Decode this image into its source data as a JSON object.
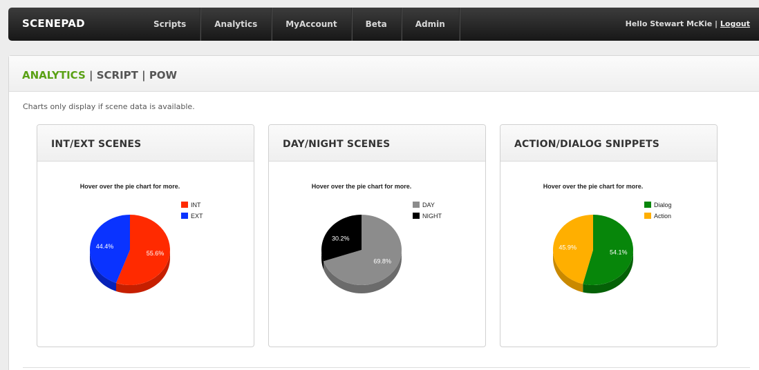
{
  "app": {
    "brand": "SCENEPAD",
    "nav": [
      "Scripts",
      "Analytics",
      "MyAccount",
      "Beta",
      "Admin"
    ],
    "greeting": "Hello Stewart McKie",
    "separator": "|",
    "logout": "Logout"
  },
  "breadcrumb": {
    "active": "ANALYTICS",
    "sep": " | ",
    "script": "SCRIPT",
    "pow": "POW"
  },
  "notice": "Charts only display if scene data is available.",
  "charts": [
    {
      "title": "INT/EXT SCENES"
    },
    {
      "title": "DAY/NIGHT SCENES"
    },
    {
      "title": "ACTION/DIALOG SNIPPETS"
    }
  ],
  "chart_data": [
    {
      "type": "pie",
      "title": "Hover over the pie chart for more.",
      "labels": [
        "INT",
        "EXT"
      ],
      "values": [
        55.6,
        44.4
      ],
      "colors": [
        "#ff2a00",
        "#0a33ff"
      ],
      "shades": [
        "#c61f00",
        "#0722b8"
      ],
      "label_colors": [
        "#ffffff",
        "#ffffff"
      ],
      "legend_position": "top-right"
    },
    {
      "type": "pie",
      "title": "Hover over the pie chart for more.",
      "labels": [
        "DAY",
        "NIGHT"
      ],
      "values": [
        69.8,
        30.2
      ],
      "colors": [
        "#8c8c8c",
        "#000000"
      ],
      "shades": [
        "#6b6b6b",
        "#000000"
      ],
      "label_colors": [
        "#ffffff",
        "#ffffff"
      ],
      "legend_position": "top-right"
    },
    {
      "type": "pie",
      "title": "Hover over the pie chart for more.",
      "labels": [
        "Dialog",
        "Action"
      ],
      "values": [
        54.1,
        45.9
      ],
      "colors": [
        "#07860a",
        "#ffaf00"
      ],
      "shades": [
        "#056107",
        "#c98900"
      ],
      "label_colors": [
        "#ffffff",
        "#ffffff"
      ],
      "legend_position": "top-right"
    }
  ]
}
